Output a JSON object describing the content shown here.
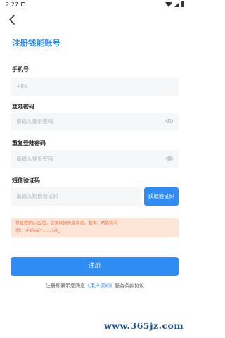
{
  "status_bar": {
    "time": "2:27"
  },
  "header": {
    "title": "注册钱能账号"
  },
  "form": {
    "phone": {
      "label": "手机号",
      "prefix": "+86"
    },
    "password": {
      "label": "登陆密码",
      "placeholder": "请输入登录密码"
    },
    "confirm_password": {
      "label": "重复登陆密码",
      "placeholder": "请输入登录密码"
    },
    "sms_code": {
      "label": "短信验证码",
      "placeholder": "请输入短信验证码",
      "button": "获取验证码"
    }
  },
  "tip": {
    "line1": "登录密码8-32位，必须同时包含字母，数字，特殊符号",
    "line2": "例：!#$%&'*+,-./?@_"
  },
  "submit_label": "注册",
  "terms": {
    "prefix": "注册即表示您同意",
    "link": "《用户须知》",
    "suffix": "服务条款协议"
  },
  "watermark": "www.365jz.com",
  "colors": {
    "accent": "#2f8cf5",
    "tip_bg": "#fde5d7",
    "tip_text": "#e8744a"
  }
}
